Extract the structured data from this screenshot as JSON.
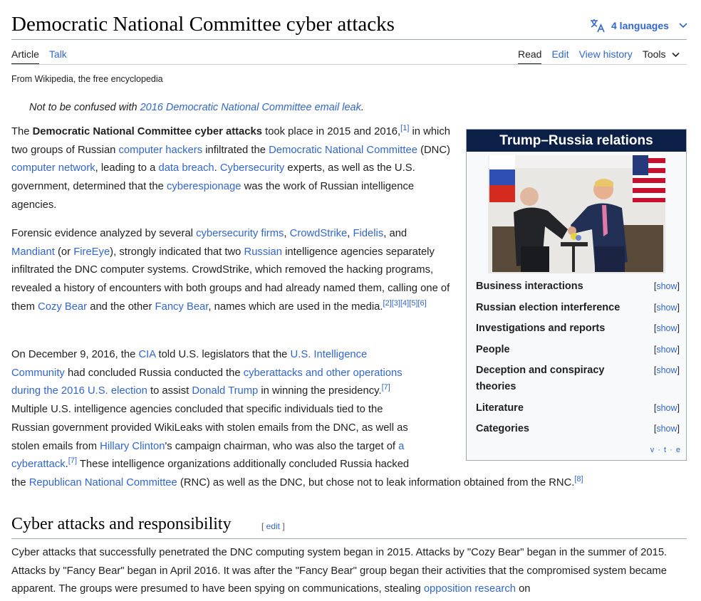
{
  "header": {
    "title": "Democratic National Committee cyber attacks",
    "languages_label": "4 languages",
    "tabs_left": [
      "Article",
      "Talk"
    ],
    "tabs_right": [
      "Read",
      "Edit",
      "View history"
    ],
    "tools_label": "Tools"
  },
  "tagline": "From Wikipedia, the free encyclopedia",
  "hatnote": {
    "prefix": "Not to be confused with ",
    "link": "2016 Democratic National Committee email leak",
    "suffix": "."
  },
  "p1": {
    "t1": "The ",
    "b1": "Democratic National Committee cyber attacks",
    "t2": " took place in 2015 and 2016,",
    "r1": "[1]",
    "t3": " in which two groups of Russian ",
    "l1": "computer hackers",
    "t4": " infiltrated the ",
    "l2": "Democratic National Committee",
    "t5": " (DNC) ",
    "l3": "computer network",
    "t6": ", leading to a ",
    "l4": "data breach",
    "t7": ". ",
    "l5": "Cybersecurity",
    "t8": " experts, as well as the U.S. government, determined that the ",
    "l6": "cyberespionage",
    "t9": " was the work of Russian intelligence agencies."
  },
  "p2": {
    "t1": "Forensic evidence analyzed by several ",
    "l1": "cybersecurity firms",
    "t2": ", ",
    "l2": "CrowdStrike",
    "t3": ", ",
    "l3": "Fidelis",
    "t4": ", and ",
    "l4": "Mandiant",
    "t5": " (or ",
    "l5": "FireEye",
    "t6": "), strongly indicated that two ",
    "l6": "Russian",
    "t7": " intelligence agencies separately infiltrated the DNC computer systems. CrowdStrike, which removed the hacking programs, revealed a history of encounters with both groups and had already named them, calling one of them ",
    "l7": "Cozy Bear",
    "t8": " and the other ",
    "l8": "Fancy Bear",
    "t9": ", names which are used in the media.",
    "r1": "[2][3][4][5][6]"
  },
  "p3": {
    "t1": "On December 9, 2016, the ",
    "l1": "CIA",
    "t2": " told U.S. legislators that the ",
    "l2a": "U.S. Intelligence",
    "l2b": "Community",
    "t3": " had concluded Russia conducted the ",
    "l3a": "cyberattacks and other operations",
    "l3b": "during the 2016 U.S. election",
    "t4": " to assist ",
    "l4": "Donald Trump",
    "t5": " in winning the presidency.",
    "r1": "[7]",
    "t6": "Multiple U.S. intelligence agencies concluded that specific individuals tied to the",
    "t7": "Russian government provided WikiLeaks with stolen emails from the DNC, as well as",
    "t8": "stolen emails from ",
    "l5": "Hillary Clinton",
    "t9": "'s campaign chairman, who was also the target of ",
    "l6a": "a",
    "l6b": "cyberattack",
    "t10": ".",
    "r2": "[7]",
    "t11": " These intelligence organizations additionally concluded Russia hacked",
    "t12": "the ",
    "l7": "Republican National Committee",
    "t13": " (RNC) as well as the DNC, but chose not to leak information obtained from the RNC.",
    "r3": "[8]"
  },
  "section": {
    "heading": "Cyber attacks and responsibility",
    "edit_open": "[ ",
    "edit_label": "edit",
    "edit_close": " ]"
  },
  "p4": {
    "t1": "Cyber attacks that successfully penetrated the DNC computing system began in 2015. Attacks by \"Cozy Bear\" began in the summer of 2015. Attacks by \"Fancy Bear\" began in April 2016. It was after the \"Fancy Bear\" group began their activities that the compromised system became apparent. The groups were presumed to have been spying on communications, stealing ",
    "l1": "opposition research",
    "t2": " on"
  },
  "infobox": {
    "title": "Trump–Russia relations",
    "rows": [
      {
        "label": "Business interactions"
      },
      {
        "label": "Russian election interference"
      },
      {
        "label": "Investigations and reports"
      },
      {
        "label": "People"
      },
      {
        "label": "Deception and conspiracy theories"
      },
      {
        "label": "Literature"
      },
      {
        "label": "Categories"
      }
    ],
    "show_open": "[",
    "show_label": "show",
    "show_close": "]",
    "vte": "v · t · e"
  }
}
